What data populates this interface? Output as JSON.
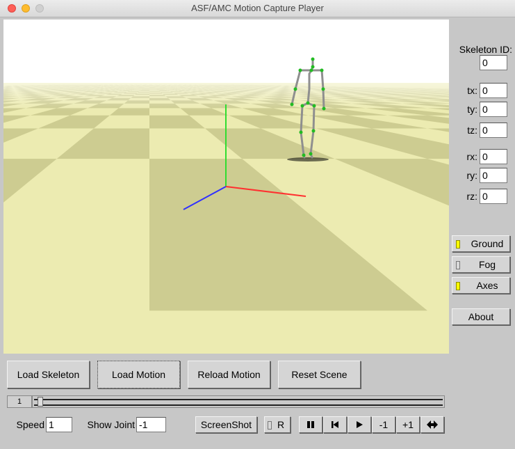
{
  "window": {
    "title": "ASF/AMC Motion Capture Player"
  },
  "side_panel": {
    "skeleton_id_label": "Skeleton ID:",
    "skeleton_id_value": "0",
    "fields": [
      {
        "label": "tx:",
        "value": "0"
      },
      {
        "label": "ty:",
        "value": "0"
      },
      {
        "label": "tz:",
        "value": "0"
      },
      {
        "label": "rx:",
        "value": "0"
      },
      {
        "label": "ry:",
        "value": "0"
      },
      {
        "label": "rz:",
        "value": "0"
      }
    ],
    "toggles": [
      {
        "label": "Ground",
        "on": true
      },
      {
        "label": "Fog",
        "on": false
      },
      {
        "label": "Axes",
        "on": true
      }
    ],
    "about_label": "About"
  },
  "buttons": {
    "load_skeleton": "Load Skeleton",
    "load_motion": "Load Motion",
    "reload_motion": "Reload Motion",
    "reset_scene": "Reset Scene"
  },
  "timeline": {
    "frame": "1",
    "position": 0.0
  },
  "controls": {
    "speed_label": "Speed",
    "speed_value": "1",
    "show_joint_label": "Show Joint",
    "show_joint_value": "-1",
    "screenshot_label": "ScreenShot",
    "record_label": "R",
    "step_back_label": "-1",
    "step_forward_label": "+1"
  },
  "colors": {
    "ground_light": "#ecebb1",
    "ground_dark": "#cdcc91",
    "axis_x": "#ff3030",
    "axis_y": "#30dd30",
    "axis_z": "#3030ff",
    "bone": "#8f8f8f",
    "joint": "#22bb22"
  }
}
